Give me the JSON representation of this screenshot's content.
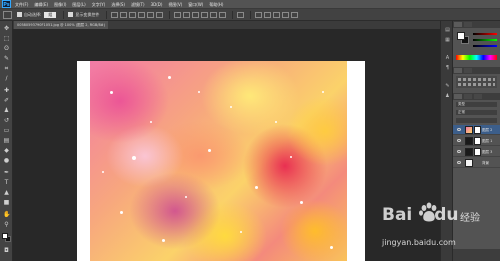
{
  "app": {
    "logo": "Ps"
  },
  "menubar": {
    "items": [
      "文件(F)",
      "编辑(E)",
      "图像(I)",
      "图层(L)",
      "文字(Y)",
      "选择(S)",
      "滤镜(T)",
      "3D(D)",
      "视图(V)",
      "窗口(W)",
      "帮助(H)"
    ]
  },
  "options": {
    "auto_select_label": "自动选择:",
    "auto_select_value": "组",
    "show_transform_label": "显示变换控件"
  },
  "document": {
    "tab_title": "00580593790F1051.jpg @ 100% (图层 2, RGB/8#)"
  },
  "layers": [
    {
      "name": "图层 2",
      "selected": true
    },
    {
      "name": "图层 1",
      "selected": false
    },
    {
      "name": "图层 3",
      "selected": false
    },
    {
      "name": "背景",
      "selected": false
    }
  ],
  "layers_panel": {
    "kind_label": "类型",
    "blend_mode": "正常"
  },
  "watermark": {
    "logo_text": "Bai",
    "logo_text_after": "du",
    "product_text": "经验",
    "url": "jingyan.baidu.com"
  },
  "colors": {
    "foreground": "#ffffff",
    "background": "#111111",
    "selected_layer": "#3c5e8a"
  }
}
